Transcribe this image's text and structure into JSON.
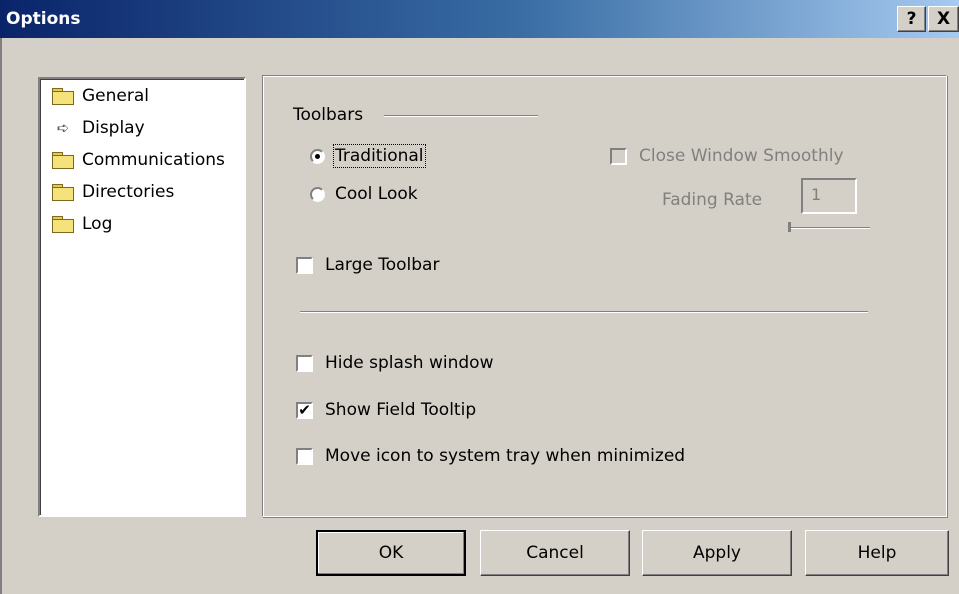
{
  "window": {
    "title": "Options",
    "help_glyph": "?",
    "close_glyph": "X"
  },
  "tree": {
    "items": [
      {
        "label": "General",
        "icon": "folder-icon"
      },
      {
        "label": "Display",
        "icon": "arrow-right-icon"
      },
      {
        "label": "Communications",
        "icon": "folder-icon"
      },
      {
        "label": "Directories",
        "icon": "folder-icon"
      },
      {
        "label": "Log",
        "icon": "folder-icon"
      }
    ]
  },
  "toolbars": {
    "section_label": "Toolbars",
    "traditional_label": "Traditional",
    "traditional_selected": true,
    "cool_look_label": "Cool Look",
    "cool_look_selected": false,
    "close_window_smoothly_label": "Close Window Smoothly",
    "close_window_smoothly_checked": false,
    "fading_rate_label": "Fading Rate",
    "fading_rate_value": "1",
    "large_toolbar_label": "Large Toolbar",
    "large_toolbar_checked": false
  },
  "options": {
    "hide_splash_label": "Hide splash window",
    "hide_splash_checked": false,
    "show_tooltip_label": "Show Field Tooltip",
    "show_tooltip_checked": true,
    "move_tray_label": "Move icon to system tray when minimized",
    "move_tray_checked": false
  },
  "buttons": {
    "ok": "OK",
    "cancel": "Cancel",
    "apply": "Apply",
    "help": "Help"
  },
  "check_glyph": "✔"
}
